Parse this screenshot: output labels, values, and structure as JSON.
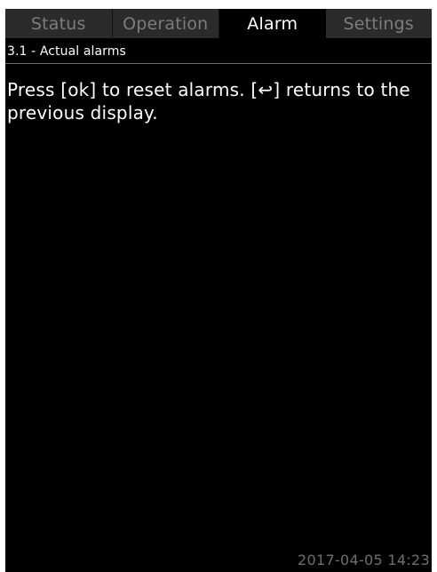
{
  "tabs": [
    {
      "label": "Status",
      "active": false
    },
    {
      "label": "Operation",
      "active": false
    },
    {
      "label": "Alarm",
      "active": true
    },
    {
      "label": "Settings",
      "active": false
    }
  ],
  "menu": {
    "title": "3.1 - Actual alarms"
  },
  "content": {
    "message": "Press [ok] to reset alarms. [↩] returns to the\nprevious display."
  },
  "footer": {
    "datetime": "2017-04-05 14:23"
  },
  "colors": {
    "background": "#000000",
    "tab_inactive_bg": "#2b2b2b",
    "tab_inactive_text": "#7c7c7c",
    "text": "#ffffff",
    "muted": "#6f6f6f"
  }
}
